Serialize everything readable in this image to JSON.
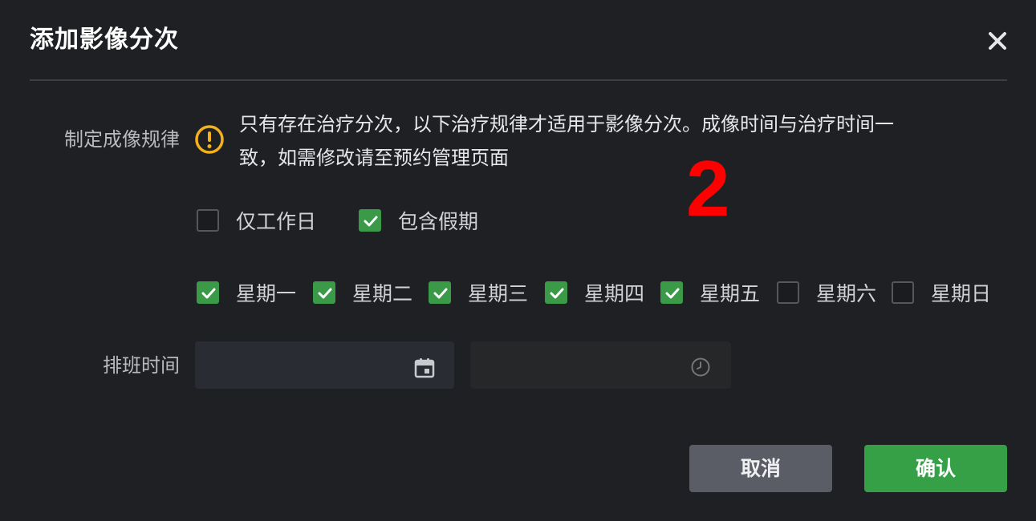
{
  "dialog": {
    "title": "添加影像分次",
    "close_icon": "close-icon"
  },
  "rule": {
    "label": "制定成像规律",
    "warning_icon": "warning-circle-icon",
    "warning_color": "#f3b11b",
    "notice_line1": "只有存在治疗分次，以下治疗规律才适用于影像分次。成像时间与治疗时间一",
    "notice_line2": "致，如需修改请至预约管理页面"
  },
  "marker_text": "2",
  "day_type": {
    "workdays_only": {
      "label": "仅工作日",
      "checked": false
    },
    "include_holidays": {
      "label": "包含假期",
      "checked": true
    }
  },
  "weekdays": [
    {
      "label": "星期一",
      "checked": true
    },
    {
      "label": "星期二",
      "checked": true
    },
    {
      "label": "星期三",
      "checked": true
    },
    {
      "label": "星期四",
      "checked": true
    },
    {
      "label": "星期五",
      "checked": true
    },
    {
      "label": "星期六",
      "checked": false
    },
    {
      "label": "星期日",
      "checked": false
    }
  ],
  "schedule": {
    "label": "排班时间",
    "date_value": "",
    "date_icon": "calendar-icon",
    "time_value": "",
    "time_icon": "clock-icon"
  },
  "buttons": {
    "cancel": "取消",
    "confirm": "确认"
  },
  "colors": {
    "background": "#1f2024",
    "checkbox_checked": "#3a9a48",
    "confirm_button": "#35a046",
    "cancel_button": "#5a5c66"
  }
}
